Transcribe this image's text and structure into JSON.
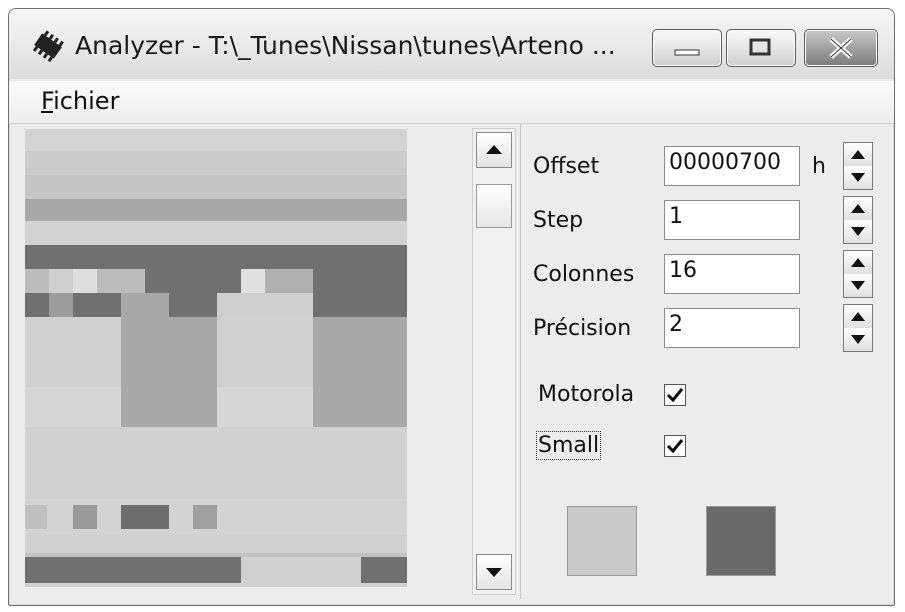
{
  "window": {
    "title": "Analyzer - T:\\_Tunes\\Nissan\\tunes\\Arteno ...",
    "app_icon": "chip-icon",
    "controls": [
      "minimize-icon",
      "maximize-icon",
      "close-icon"
    ]
  },
  "menu": {
    "items": [
      {
        "mnemonic": "F",
        "rest": "ichier"
      }
    ]
  },
  "settings": {
    "offset": {
      "label": "Offset",
      "value": "00000700",
      "unit": "h"
    },
    "step": {
      "label": "Step",
      "value": "1"
    },
    "colonnes": {
      "label": "Colonnes",
      "value": "16"
    },
    "precision": {
      "label": "Précision",
      "value": "2"
    },
    "motorola": {
      "label": "Motorola",
      "checked": true
    },
    "small": {
      "label": "Small",
      "checked": true
    }
  },
  "swatches": {
    "low_color": "#c9c9c9",
    "high_color": "#6a6a6a"
  },
  "heatmap_colors": {
    "light": "#cfcfcf",
    "mid": "#a8a8a8",
    "dark": "#707070"
  }
}
